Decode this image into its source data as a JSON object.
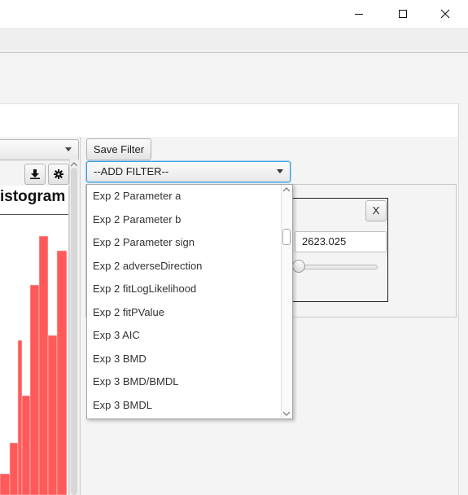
{
  "window": {
    "controls": [
      {
        "name": "minimize",
        "icon": "minimize-icon"
      },
      {
        "name": "maximize",
        "icon": "maximize-icon"
      },
      {
        "name": "close",
        "icon": "close-icon"
      }
    ]
  },
  "chart_panel": {
    "title": "istogram",
    "toolbar_icons": [
      "download-icon",
      "gear-icon"
    ],
    "bar_color": "#ff5a5a"
  },
  "filter_panel": {
    "save_filter_label": "Save Filter",
    "add_filter": {
      "selected": "--ADD FILTER--",
      "options": [
        "Exp 2 Parameter a",
        "Exp 2 Parameter b",
        "Exp 2 Parameter sign",
        "Exp 2 adverseDirection",
        "Exp 2 fitLogLikelihood",
        "Exp 2 fitPValue",
        "Exp 3 AIC",
        "Exp 3 BMD",
        "Exp 3 BMD/BMDL",
        "Exp 3 BMDL"
      ]
    },
    "filter_card": {
      "close_label": "X",
      "value": "2623.025",
      "slider_level": 0.05
    }
  },
  "colors": {
    "accent_focus": "#3b9fe0",
    "bar": "#ff5a5a"
  }
}
